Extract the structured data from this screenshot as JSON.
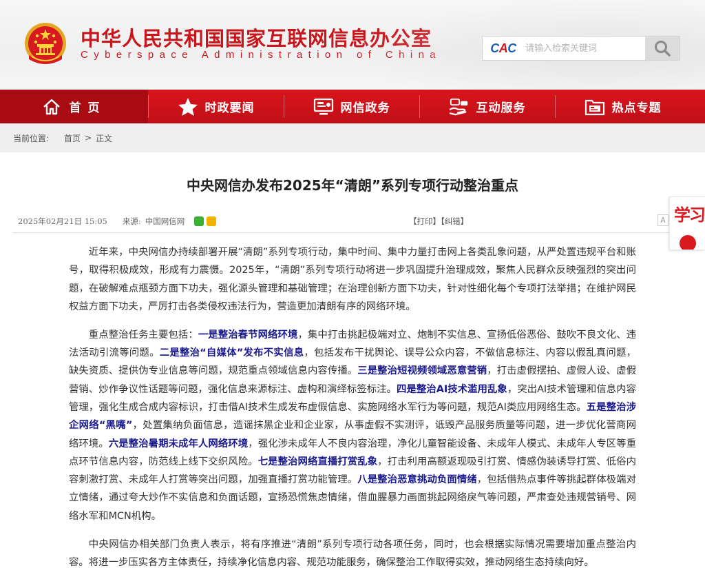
{
  "header": {
    "title": "中华人民共和国国家互联网信息办公室",
    "subtitle": "Cyberspace Administration of China",
    "emblem_icon": "national-emblem-icon",
    "search": {
      "logo_text": "CAC",
      "placeholder": "请输入检索关键词",
      "button_icon": "search-icon"
    }
  },
  "nav": {
    "items": [
      {
        "label": "首页",
        "icon": "home-icon"
      },
      {
        "label": "时政要闻",
        "icon": "star-icon"
      },
      {
        "label": "网信政务",
        "icon": "monitor-icon"
      },
      {
        "label": "互动服务",
        "icon": "handshake-icon"
      },
      {
        "label": "热点专题",
        "icon": "folder-icon"
      }
    ]
  },
  "breadcrumb": {
    "prefix": "当前位置:",
    "home": "首页",
    "separator": ">",
    "current": "正文"
  },
  "article": {
    "title": "中央网信办发布2025年“清朗”系列专项行动整治重点",
    "date": "2025年02月21日 15:05",
    "source_label": "来源:",
    "source": "中国网信网",
    "print": "【打印】",
    "correct": "【纠错】",
    "font_toggle": "A",
    "p1": "近年来，中央网信办持续部署开展“清朗”系列专项行动，集中时间、集中力量打击网上各类乱象问题，从严处置违规平台和账号，取得积极成效，形成有力震慑。2025年，“清朗”系列专项行动将进一步巩固提升治理成效，聚焦人民群众反映强烈的突出问题，在破解难点瓶颈方面下功夫，强化源头管理和基础管理；在治理创新方面下功夫，针对性细化每个专项打法举措；在维护网民权益方面下功夫，严厉打击各类侵权违法行为，营造更加清朗有序的网络环境。",
    "p2": [
      {
        "t": "重点整治任务主要包括：",
        "b": false
      },
      {
        "t": "一是整治春节网络环境",
        "b": true
      },
      {
        "t": "，集中打击挑起极端对立、炮制不实信息、宣扬低俗恶俗、鼓吹不良文化、违法活动引流等问题。",
        "b": false
      },
      {
        "t": "二是整治“自媒体”发布不实信息",
        "b": true
      },
      {
        "t": "，包括发布干扰舆论、误导公众内容，不做信息标注、内容以假乱真问题，缺失资质、提供伪专业信息等问题，规范重点领域信息内容传播。",
        "b": false
      },
      {
        "t": "三是整治短视频领域恶意营销",
        "b": true
      },
      {
        "t": "，打击虚假摆拍、虚假人设、虚假营销、炒作争议性话题等问题，强化信息来源标注、虚构和演绎标签标注。",
        "b": false
      },
      {
        "t": "四是整治AI技术滥用乱象",
        "b": true
      },
      {
        "t": "，突出AI技术管理和信息内容管理，强化生成合成内容标识，打击借AI技术生成发布虚假信息、实施网络水军行为等问题，规范AI类应用网络生态。",
        "b": false
      },
      {
        "t": "五是整治涉企网络“黑嘴”",
        "b": true
      },
      {
        "t": "，处置集纳负面信息，造谣抹黑企业和企业家，从事虚假不实测评，诋毁产品服务质量等问题，进一步优化营商网络环境。",
        "b": false
      },
      {
        "t": "六是整治暑期未成年人网络环境",
        "b": true
      },
      {
        "t": "，强化涉未成年人不良内容治理，净化儿童智能设备、未成年人模式、未成年人专区等重点环节信息内容，防范线上线下交织风险。",
        "b": false
      },
      {
        "t": "七是整治网络直播打赏乱象",
        "b": true
      },
      {
        "t": "，打击利用高额返现吸引打赏、情感伪装诱导打赏、低俗内容刺激打赏、未成年人打赏等突出问题，加强直播打赏功能管理。",
        "b": false
      },
      {
        "t": "八是整治恶意挑动负面情绪",
        "b": true
      },
      {
        "t": "，包括借热点事件等挑起群体极端对立情绪，通过夸大炒作不实信息和负面话题，宣扬恐慌焦虑情绪，借血腥暴力画面挑起网络戾气等问题，严肃查处违规营销号、网络水军和MCN机构。",
        "b": false
      }
    ],
    "p3": "中央网信办相关部门负责人表示，将有序推进“清朗”系列专项行动各项任务，同时，也会根据实际情况需要增加重点整治内容。将进一步压实各方主体责任，持续净化信息内容、规范功能服务，确保整治工作取得实效，推动网络生态持续向好。"
  },
  "side_badge": {
    "label": "学习",
    "icon": "xuexi-badge-icon"
  },
  "colors": {
    "brand_red": "#c8161d",
    "nav_red": "#d8141c",
    "highlight_blue": "#1a1a8c"
  }
}
